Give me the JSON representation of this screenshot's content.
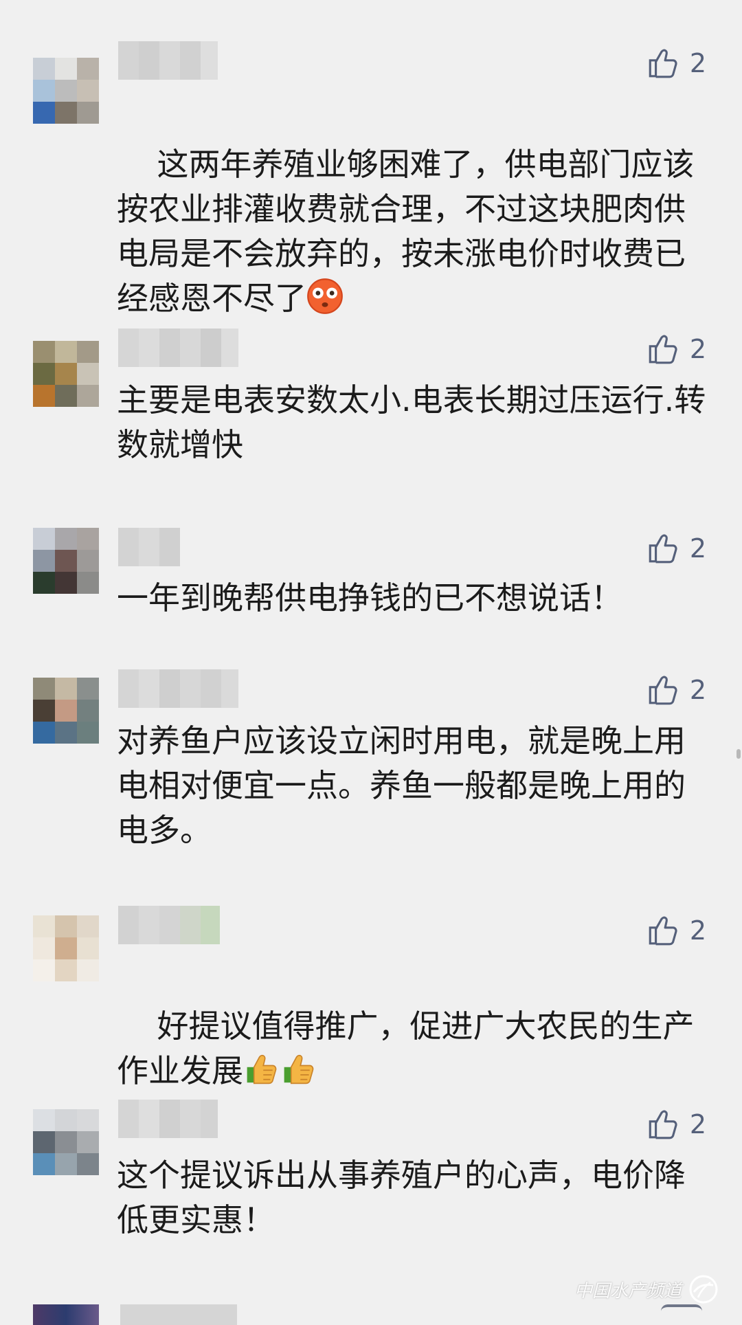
{
  "comments": [
    {
      "name": "",
      "likes": "2",
      "text": "这两年养殖业够困难了，供电部门应该按农业排灌收费就合理，不过这块肥肉供电局是不会放弃的，按未涨电价时收费已经感恩不尽了",
      "emoji": "flushed-face-emoji"
    },
    {
      "name": "",
      "likes": "2",
      "text": "主要是电表安数太小.电表长期过压运行.转数就增快"
    },
    {
      "name": "",
      "likes": "2",
      "text": "一年到晚帮供电挣钱的已不想说话！"
    },
    {
      "name": "",
      "likes": "2",
      "text": "对养鱼户应该设立闲时用电，就是晚上用电相对便宜一点。养鱼一般都是晚上用的电多。"
    },
    {
      "name": "",
      "likes": "2",
      "text": "好提议值得推广，促进广大农民的生产作业发展",
      "emoji": "thumbs-up-emoji"
    },
    {
      "name": "",
      "likes": "2",
      "text": "这个提议诉出从事养殖户的心声，电价降低更实惠！"
    }
  ],
  "watermark": {
    "text": "中国水产频道"
  },
  "colors": {
    "background": "#f0f0f0",
    "text": "#1b1b1b",
    "like_icon": "#55607a"
  }
}
